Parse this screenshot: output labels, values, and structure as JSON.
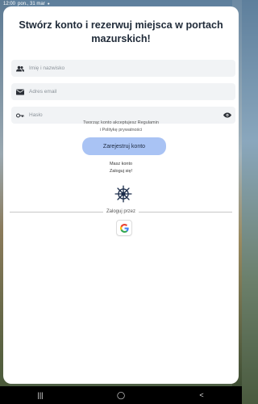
{
  "status_bar": {
    "time": "12:00",
    "date": "pon., 31 mar"
  },
  "page": {
    "title": "Stwórz konto i rezerwuj miejsca w portach mazurskich!"
  },
  "form": {
    "name_placeholder": "Imię i nazwisko",
    "email_placeholder": "Adres email",
    "password_placeholder": "Hasło",
    "terms_line1": "Tworząc konto akceptujesz Regulamin",
    "terms_line2": "i Politykę prywatności",
    "register_label": "Zarejestruj konto",
    "has_account": "Masz konto",
    "login_link": "Zaloguj się!",
    "login_via": "Zaloguj przez"
  },
  "icons": {
    "name": "people-icon",
    "email": "envelope-icon",
    "password": "key-icon",
    "visibility": "eye-icon",
    "logo": "ship-wheel-icon",
    "google": "google-icon"
  },
  "colors": {
    "primary_button": "#a9c3f4",
    "field_bg": "#f1f3f5",
    "title": "#1f2a38",
    "wheel": "#1b2c4a"
  }
}
